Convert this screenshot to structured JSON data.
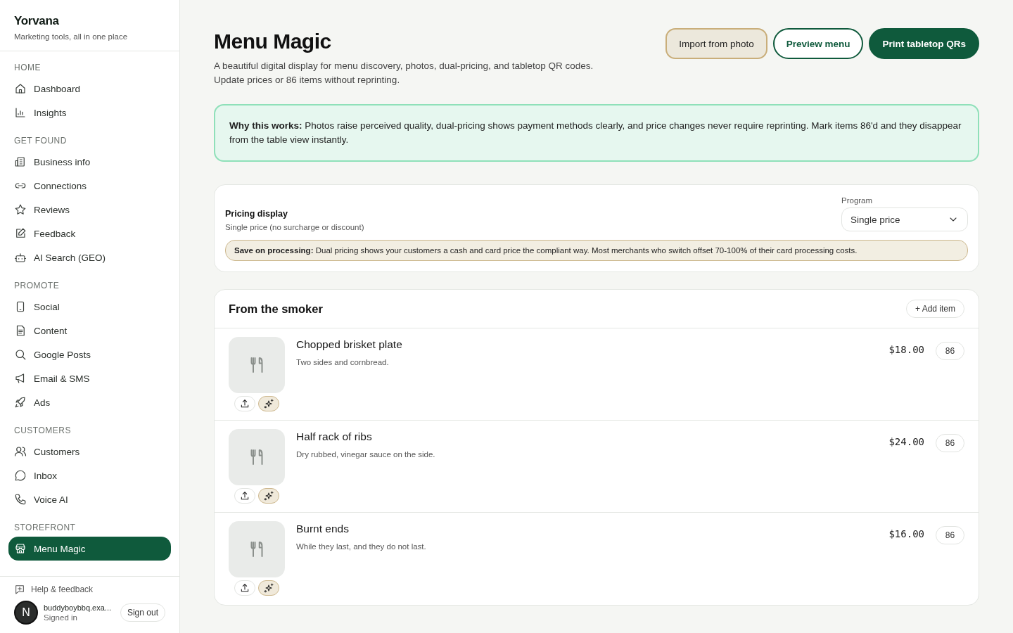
{
  "brand": {
    "name": "Yorvana",
    "tagline": "Marketing tools, all in one place"
  },
  "nav": [
    {
      "heading": "HOME",
      "items": [
        {
          "label": "Dashboard",
          "selected": false
        },
        {
          "label": "Insights",
          "selected": false
        }
      ]
    },
    {
      "heading": "GET FOUND",
      "items": [
        {
          "label": "Business info",
          "selected": false
        },
        {
          "label": "Connections",
          "selected": false
        },
        {
          "label": "Reviews",
          "selected": false
        },
        {
          "label": "Feedback",
          "selected": false
        },
        {
          "label": "AI Search (GEO)",
          "selected": false
        }
      ]
    },
    {
      "heading": "PROMOTE",
      "items": [
        {
          "label": "Social",
          "selected": false
        },
        {
          "label": "Content",
          "selected": false
        },
        {
          "label": "Google Posts",
          "selected": false
        },
        {
          "label": "Email & SMS",
          "selected": false
        },
        {
          "label": "Ads",
          "selected": false
        }
      ]
    },
    {
      "heading": "CUSTOMERS",
      "items": [
        {
          "label": "Customers",
          "selected": false
        },
        {
          "label": "Inbox",
          "selected": false
        },
        {
          "label": "Voice AI",
          "selected": false
        }
      ]
    },
    {
      "heading": "STOREFRONT",
      "items": [
        {
          "label": "Menu Magic",
          "selected": true
        }
      ]
    }
  ],
  "footer": {
    "help": "Help & feedback",
    "avatar": "N",
    "email": "buddyboybbq.exa...",
    "status": "Signed in",
    "sign_out": "Sign out"
  },
  "page": {
    "title": "Menu Magic",
    "subtitle": [
      "A beautiful digital display for menu discovery, photos, dual-pricing, and tabletop QR codes.",
      "Update prices or 86 items without reprinting."
    ],
    "actions": [
      {
        "label": "Import from photo",
        "kind": "soft"
      },
      {
        "label": "Preview menu",
        "kind": "outline"
      },
      {
        "label": "Print tabletop QRs",
        "kind": "primary"
      }
    ]
  },
  "callout": "**Why this works:** Photos raise perceived quality, dual-pricing shows payment methods clearly, and price changes never require reprinting. Mark items 86'd and they disappear from the table view instantly.",
  "pricing": {
    "title": "Pricing display",
    "description": "Single price (no surcharge or discount)",
    "program_label": "Program",
    "program_value": "Single price",
    "notice": "**Save on processing:** Dual pricing shows your customers a cash and card price the compliant way. Most merchants who switch offset 70-100% of their card processing costs."
  },
  "section": {
    "title": "From the smoker",
    "add_button": "+ Add item",
    "items": [
      {
        "name": "Chopped brisket plate",
        "description": "Two sides and cornbread.",
        "price": "$18.00",
        "toggle": "86"
      },
      {
        "name": "Half rack of ribs",
        "description": "Dry rubbed, vinegar sauce on the side.",
        "price": "$24.00",
        "toggle": "86"
      },
      {
        "name": "Burnt ends",
        "description": "While they last, and they do not last.",
        "price": "$16.00",
        "toggle": "86"
      }
    ]
  }
}
